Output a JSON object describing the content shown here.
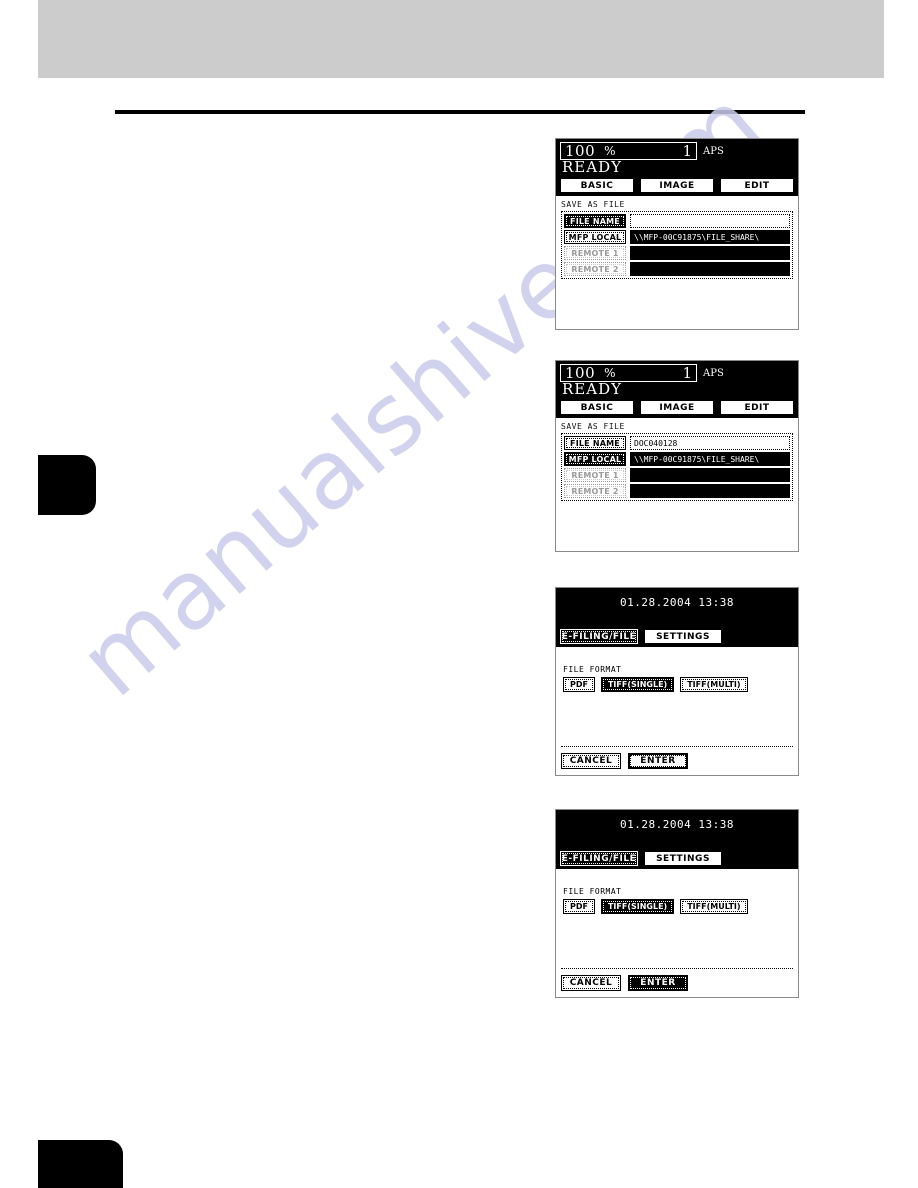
{
  "page": {
    "watermark_text": "manualshive.com"
  },
  "panels": [
    {
      "id": "save-as-file-empty",
      "status": {
        "zoom": "100",
        "percent_symbol": "%",
        "copy_count": "1",
        "paper_mode": "APS",
        "machine_state": "READY"
      },
      "tabs": [
        {
          "label": "BASIC",
          "selected": false
        },
        {
          "label": "IMAGE",
          "selected": false
        },
        {
          "label": "EDIT",
          "selected": false
        }
      ],
      "section_label": "SAVE AS FILE",
      "rows": [
        {
          "button": "FILE NAME",
          "state": "selected",
          "value": "",
          "value_style": "plain"
        },
        {
          "button": "MFP LOCAL",
          "state": "normal",
          "value": "\\\\MFP-00C91875\\FILE_SHARE\\",
          "value_style": "inverted"
        },
        {
          "button": "REMOTE 1",
          "state": "disabled",
          "value": "",
          "value_style": "blank"
        },
        {
          "button": "REMOTE 2",
          "state": "disabled",
          "value": "",
          "value_style": "blank"
        }
      ]
    },
    {
      "id": "save-as-file-named",
      "status": {
        "zoom": "100",
        "percent_symbol": "%",
        "copy_count": "1",
        "paper_mode": "APS",
        "machine_state": "READY"
      },
      "tabs": [
        {
          "label": "BASIC",
          "selected": false
        },
        {
          "label": "IMAGE",
          "selected": false
        },
        {
          "label": "EDIT",
          "selected": false
        }
      ],
      "section_label": "SAVE AS FILE",
      "rows": [
        {
          "button": "FILE NAME",
          "state": "normal",
          "value": "DOC040128",
          "value_style": "plain"
        },
        {
          "button": "MFP LOCAL",
          "state": "selected",
          "value": "\\\\MFP-00C91875\\FILE_SHARE\\",
          "value_style": "inverted"
        },
        {
          "button": "REMOTE 1",
          "state": "disabled",
          "value": "",
          "value_style": "blank"
        },
        {
          "button": "REMOTE 2",
          "state": "disabled",
          "value": "",
          "value_style": "blank"
        }
      ]
    },
    {
      "id": "file-format-enter-focused",
      "datetime": "01.28.2004 13:38",
      "tabs": [
        {
          "label": "E-FILING/FILE",
          "selected": true
        },
        {
          "label": "SETTINGS",
          "selected": false
        }
      ],
      "format_label": "FILE FORMAT",
      "format_options": [
        {
          "label": "PDF",
          "selected": false
        },
        {
          "label": "TIFF(SINGLE)",
          "selected": true
        },
        {
          "label": "TIFF(MULTI)",
          "selected": false
        }
      ],
      "actions": [
        {
          "label": "CANCEL",
          "state": "normal"
        },
        {
          "label": "ENTER",
          "state": "focus"
        }
      ]
    },
    {
      "id": "file-format-enter-pressed",
      "datetime": "01.28.2004 13:38",
      "tabs": [
        {
          "label": "E-FILING/FILE",
          "selected": true
        },
        {
          "label": "SETTINGS",
          "selected": false
        }
      ],
      "format_label": "FILE FORMAT",
      "format_options": [
        {
          "label": "PDF",
          "selected": false
        },
        {
          "label": "TIFF(SINGLE)",
          "selected": true
        },
        {
          "label": "TIFF(MULTI)",
          "selected": false
        }
      ],
      "actions": [
        {
          "label": "CANCEL",
          "state": "normal"
        },
        {
          "label": "ENTER",
          "state": "pressed"
        }
      ]
    }
  ]
}
